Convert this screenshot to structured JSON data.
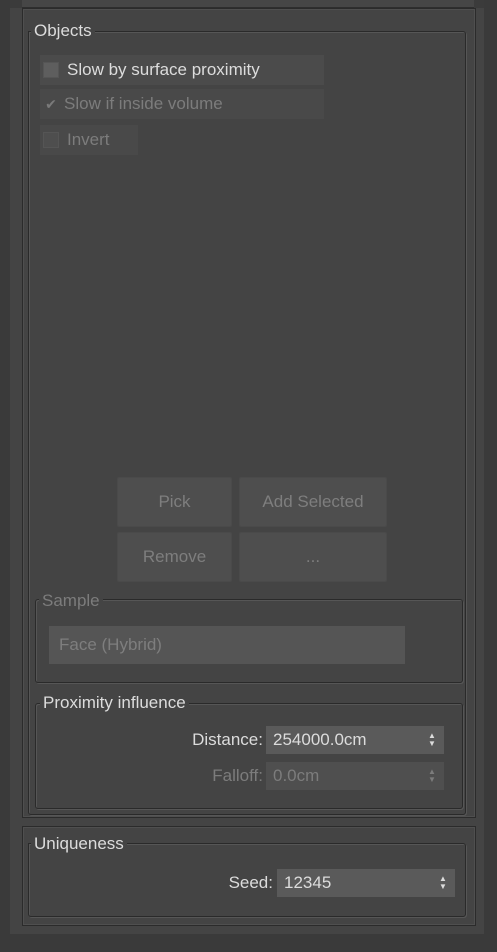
{
  "objects": {
    "title": "Objects",
    "slow_by_surface_proximity": {
      "label": "Slow by surface proximity",
      "checked": false
    },
    "slow_if_inside_volume": {
      "label": "Slow if inside volume",
      "checked": true,
      "check_glyph": "✔"
    },
    "invert": {
      "label": "Invert",
      "checked": false
    },
    "buttons": {
      "pick": "Pick",
      "add_selected": "Add Selected",
      "remove": "Remove",
      "more": "..."
    }
  },
  "sample": {
    "title": "Sample",
    "mode": "Face (Hybrid)"
  },
  "proximity_influence": {
    "title": "Proximity influence",
    "distance_label": "Distance:",
    "distance_value": "254000.0cm",
    "falloff_label": "Falloff:",
    "falloff_value": "0.0cm"
  },
  "uniqueness": {
    "title": "Uniqueness",
    "seed_label": "Seed:",
    "seed_value": "12345"
  },
  "icons": {
    "spinner_up": "▲",
    "spinner_down": "▼"
  },
  "colors": {
    "panel_bg": "#444444",
    "text": "#dcdcdc",
    "disabled_text": "#7c7c7c"
  }
}
